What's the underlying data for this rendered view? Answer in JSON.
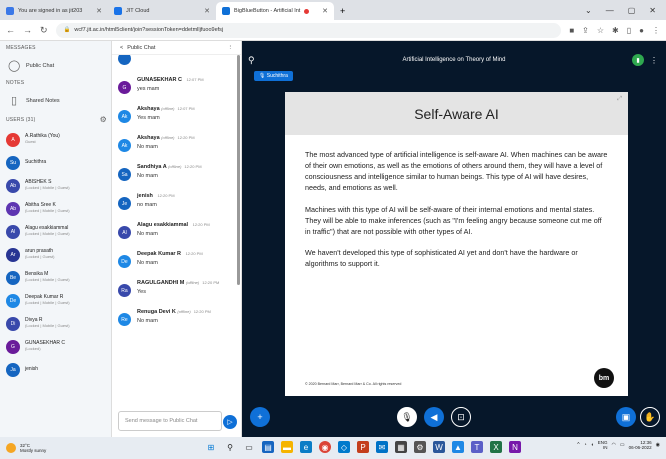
{
  "browser": {
    "tabs": [
      {
        "label": "You are signed in as jit203",
        "color": "#3b78e7"
      },
      {
        "label": "JIT Cloud",
        "color": "#1a73e8"
      },
      {
        "label": "BigBlueButton - Artificial Int",
        "color": "#0f70d7"
      }
    ],
    "new_tab": "+",
    "url": "wcf7.jit.ac.in/html5client/join?sessionToken=ddetmlljfuoo9efsj"
  },
  "left": {
    "messages_header": "MESSAGES",
    "public_chat": "Public Chat",
    "notes_header": "NOTES",
    "shared_notes": "Shared Notes",
    "users_header": "USERS (31)",
    "users": [
      {
        "initials": "A",
        "name": "A.Rathika (You)",
        "sub": "Guest",
        "color": "#e53935"
      },
      {
        "initials": "Su",
        "name": "Suchithra",
        "sub": "",
        "color": "#1565c0"
      },
      {
        "initials": "Ab",
        "name": "ABISHEK S",
        "sub": "(Locked | Mobile | Guest)",
        "color": "#3949ab"
      },
      {
        "initials": "Ab",
        "name": "Abitha Sree K",
        "sub": "(Locked | Mobile | Guest)",
        "color": "#5e35b1"
      },
      {
        "initials": "Al",
        "name": "Alagu esakkiammal",
        "sub": "(Locked | Mobile | Guest)",
        "color": "#3949ab"
      },
      {
        "initials": "Ar",
        "name": "arun prasath",
        "sub": "(Locked | Guest)",
        "color": "#283593"
      },
      {
        "initials": "Be",
        "name": "Bensika M",
        "sub": "(Locked | Mobile | Guest)",
        "color": "#1565c0"
      },
      {
        "initials": "De",
        "name": "Deepak Kumar R",
        "sub": "(Locked | Mobile | Guest)",
        "color": "#1e88e5"
      },
      {
        "initials": "Di",
        "name": "Divya R",
        "sub": "(Locked | Mobile | Guest)",
        "color": "#3949ab"
      },
      {
        "initials": "G",
        "name": "GUNASEKHAR C",
        "sub": "(Locked)",
        "color": "#6a1b9a"
      },
      {
        "initials": "Ja",
        "name": "jenish",
        "sub": "",
        "color": "#1565c0"
      }
    ]
  },
  "chat": {
    "header": "Public Chat",
    "back": "<",
    "messages": [
      {
        "initials": "",
        "name": "",
        "time": "",
        "offline": "",
        "text": "Yes mam",
        "color": "#1565c0"
      },
      {
        "initials": "G",
        "name": "GUNASEKHAR C",
        "time": "12:07 PM",
        "offline": "",
        "text": "yes mam",
        "color": "#6a1b9a"
      },
      {
        "initials": "Ak",
        "name": "Akshaya",
        "time": "12:07 PM",
        "offline": "(offline)",
        "text": "Yes mam",
        "color": "#1e88e5"
      },
      {
        "initials": "Ak",
        "name": "Akshaya",
        "time": "12:20 PM",
        "offline": "(offline)",
        "text": "No mam",
        "color": "#1e88e5"
      },
      {
        "initials": "Sa",
        "name": "Sandhiya A",
        "time": "12:20 PM",
        "offline": "(offline)",
        "text": "No mam",
        "color": "#1565c0"
      },
      {
        "initials": "Je",
        "name": "jenish",
        "time": "12:20 PM",
        "offline": "",
        "text": "no mam",
        "color": "#1565c0"
      },
      {
        "initials": "Al",
        "name": "Alagu esakkiammal",
        "time": "12:20 PM",
        "offline": "",
        "text": "No mam",
        "color": "#3949ab"
      },
      {
        "initials": "De",
        "name": "Deepak Kumar R",
        "time": "12:20 PM",
        "offline": "",
        "text": "No mam",
        "color": "#1e88e5"
      },
      {
        "initials": "Ra",
        "name": "RAGULGANDHI M",
        "time": "12:20 PM",
        "offline": "(offline)",
        "text": "Yes",
        "color": "#3949ab"
      },
      {
        "initials": "Re",
        "name": "Renuga Devi K",
        "time": "12:20 PM",
        "offline": "(offline)",
        "text": "No mam",
        "color": "#1e88e5"
      }
    ],
    "compose_placeholder": "Send message to Public Chat"
  },
  "meeting": {
    "title": "Artificial Intelligence on Theory of Mind",
    "presenter": "Suchithra",
    "slide": {
      "title": "Self-Aware AI",
      "paragraphs": [
        "The most advanced type of artificial intelligence is self-aware AI. When machines can be aware of their own emotions, as well as the emotions of others around them, they will have a level of consciousness and intelligence similar to human beings. This type of AI will have desires, needs, and emotions as well.",
        "Machines with this type of AI will be self-aware of their internal emotions and mental states. They will be able to make inferences (such as \"I'm feeling angry because someone cut me off in traffic\") that are not possible with other types of AI.",
        "We haven't developed this type of sophisticated AI yet and don't have the hardware or algorithms to support it."
      ],
      "copyright": "© 2020 Bernard Marr, Bernard Marr & Co. All rights reserved",
      "logo": "bm"
    }
  },
  "taskbar": {
    "temp": "32°C",
    "weather": "Mostly sunny",
    "lang": "ENG",
    "region": "IN",
    "time": "12:36",
    "date": "06-06-2022"
  }
}
